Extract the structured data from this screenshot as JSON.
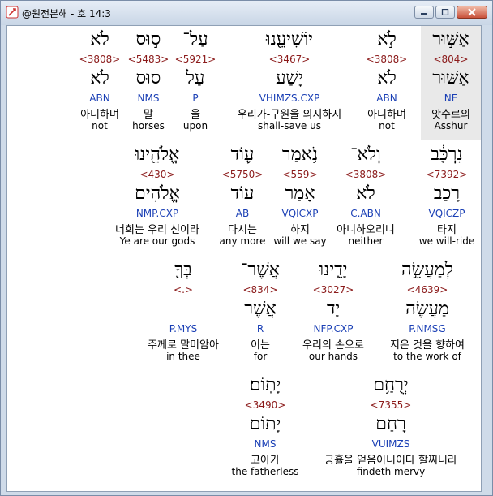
{
  "window": {
    "title": "@원전본해 - 호 14:3"
  },
  "rows": [
    {
      "cols": [
        {
          "id": "c1",
          "heb": "לֹא",
          "num": "<3808>",
          "lemma": "לֹא",
          "code": "ABN",
          "kor": "아니하며",
          "eng": "not"
        },
        {
          "id": "c2",
          "heb": "ס֣וּס",
          "num": "<5483>",
          "lemma": "סוּס",
          "code": "NMS",
          "kor": "말",
          "eng": "horses"
        },
        {
          "id": "c3",
          "heb": "עַל־",
          "num": "<5921>",
          "lemma": "עַל",
          "code": "P",
          "kor": "을",
          "eng": "upon"
        },
        {
          "id": "c4",
          "heb": "יוֹשִׁיעֵ֖נוּ",
          "num": "<3467>",
          "lemma": "יָשַׁע",
          "code": "VHIMZS.CXP",
          "kor": "우리가-구원을 의지하지",
          "eng": "shall-save us"
        },
        {
          "id": "c5",
          "heb": "לֹ֣א",
          "num": "<3808>",
          "lemma": "לֹא",
          "code": "ABN",
          "kor": "아니하며",
          "eng": "not"
        },
        {
          "id": "c6",
          "heb": "אַשּׁ֣וּר",
          "num": "<804>",
          "lemma": "אַשּׁוּר",
          "code": "NE",
          "kor": "앗수르의",
          "eng": "Asshur"
        }
      ]
    },
    {
      "cols": [
        {
          "id": "d1",
          "heb": "אֱלֹהֵ֖ינוּ",
          "num": "<430>",
          "lemma": "אֱלֹהִים",
          "code": "NMP.CXP",
          "kor": "너희는 우리 신이라",
          "eng": "Ye are our gods"
        },
        {
          "id": "d2",
          "heb": "ע֛וֹד",
          "num": "<5750>",
          "lemma": "עוֹד",
          "code": "AB",
          "kor": "다시는",
          "eng": "any more"
        },
        {
          "id": "d3",
          "heb": "נֹ֥אמַר",
          "num": "<559>",
          "lemma": "אָמַר",
          "code": "VQICXP",
          "kor": "하지",
          "eng": "will we say"
        },
        {
          "id": "d4",
          "heb": "וְלֹא־",
          "num": "<3808>",
          "lemma": "לֹא",
          "code": "C.ABN",
          "kor": "아니하오리니",
          "eng": "neither"
        },
        {
          "id": "d5",
          "heb": "נִרְכָּ֔ב",
          "num": "<7392>",
          "lemma": "רָכַב",
          "code": "VQICZP",
          "kor": "타지",
          "eng": "we will-ride"
        }
      ]
    },
    {
      "cols": [
        {
          "id": "e1",
          "heb": "בְּךָ֖",
          "num": "<.>",
          "lemma": "",
          "code": "P.MYS",
          "kor": "주께로 말미암아",
          "eng": "in thee"
        },
        {
          "id": "e2",
          "heb": "אֲשֶׁר־",
          "num": "<834>",
          "lemma": "אֲשֶׁר",
          "code": "R",
          "kor": "이는",
          "eng": "for"
        },
        {
          "id": "e3",
          "heb": "יָדֵ֑ינוּ",
          "num": "<3027>",
          "lemma": "יָד",
          "code": "NFP.CXP",
          "kor": "우리의 손으로",
          "eng": "our hands"
        },
        {
          "id": "e4",
          "heb": "לְמַעֲשֵׂ֣ה",
          "num": "<4639>",
          "lemma": "מַעֲשֶׂה",
          "code": "P.NMSG",
          "kor": "지은 것을 향하여",
          "eng": "to the work of"
        }
      ]
    },
    {
      "cols": [
        {
          "id": "f1",
          "heb": "יָתֽוֹם׃",
          "num": "<3490>",
          "lemma": "יָתוֹם",
          "code": "NMS",
          "kor": "고아가",
          "eng": "the fatherless"
        },
        {
          "id": "f2",
          "heb": "יְרֻחַ֥ם",
          "num": "<7355>",
          "lemma": "רָחַם",
          "code": "VUIMZS",
          "kor": "긍휼을 얻음이니이다 할찌니라",
          "eng": "findeth mervy"
        }
      ]
    }
  ]
}
